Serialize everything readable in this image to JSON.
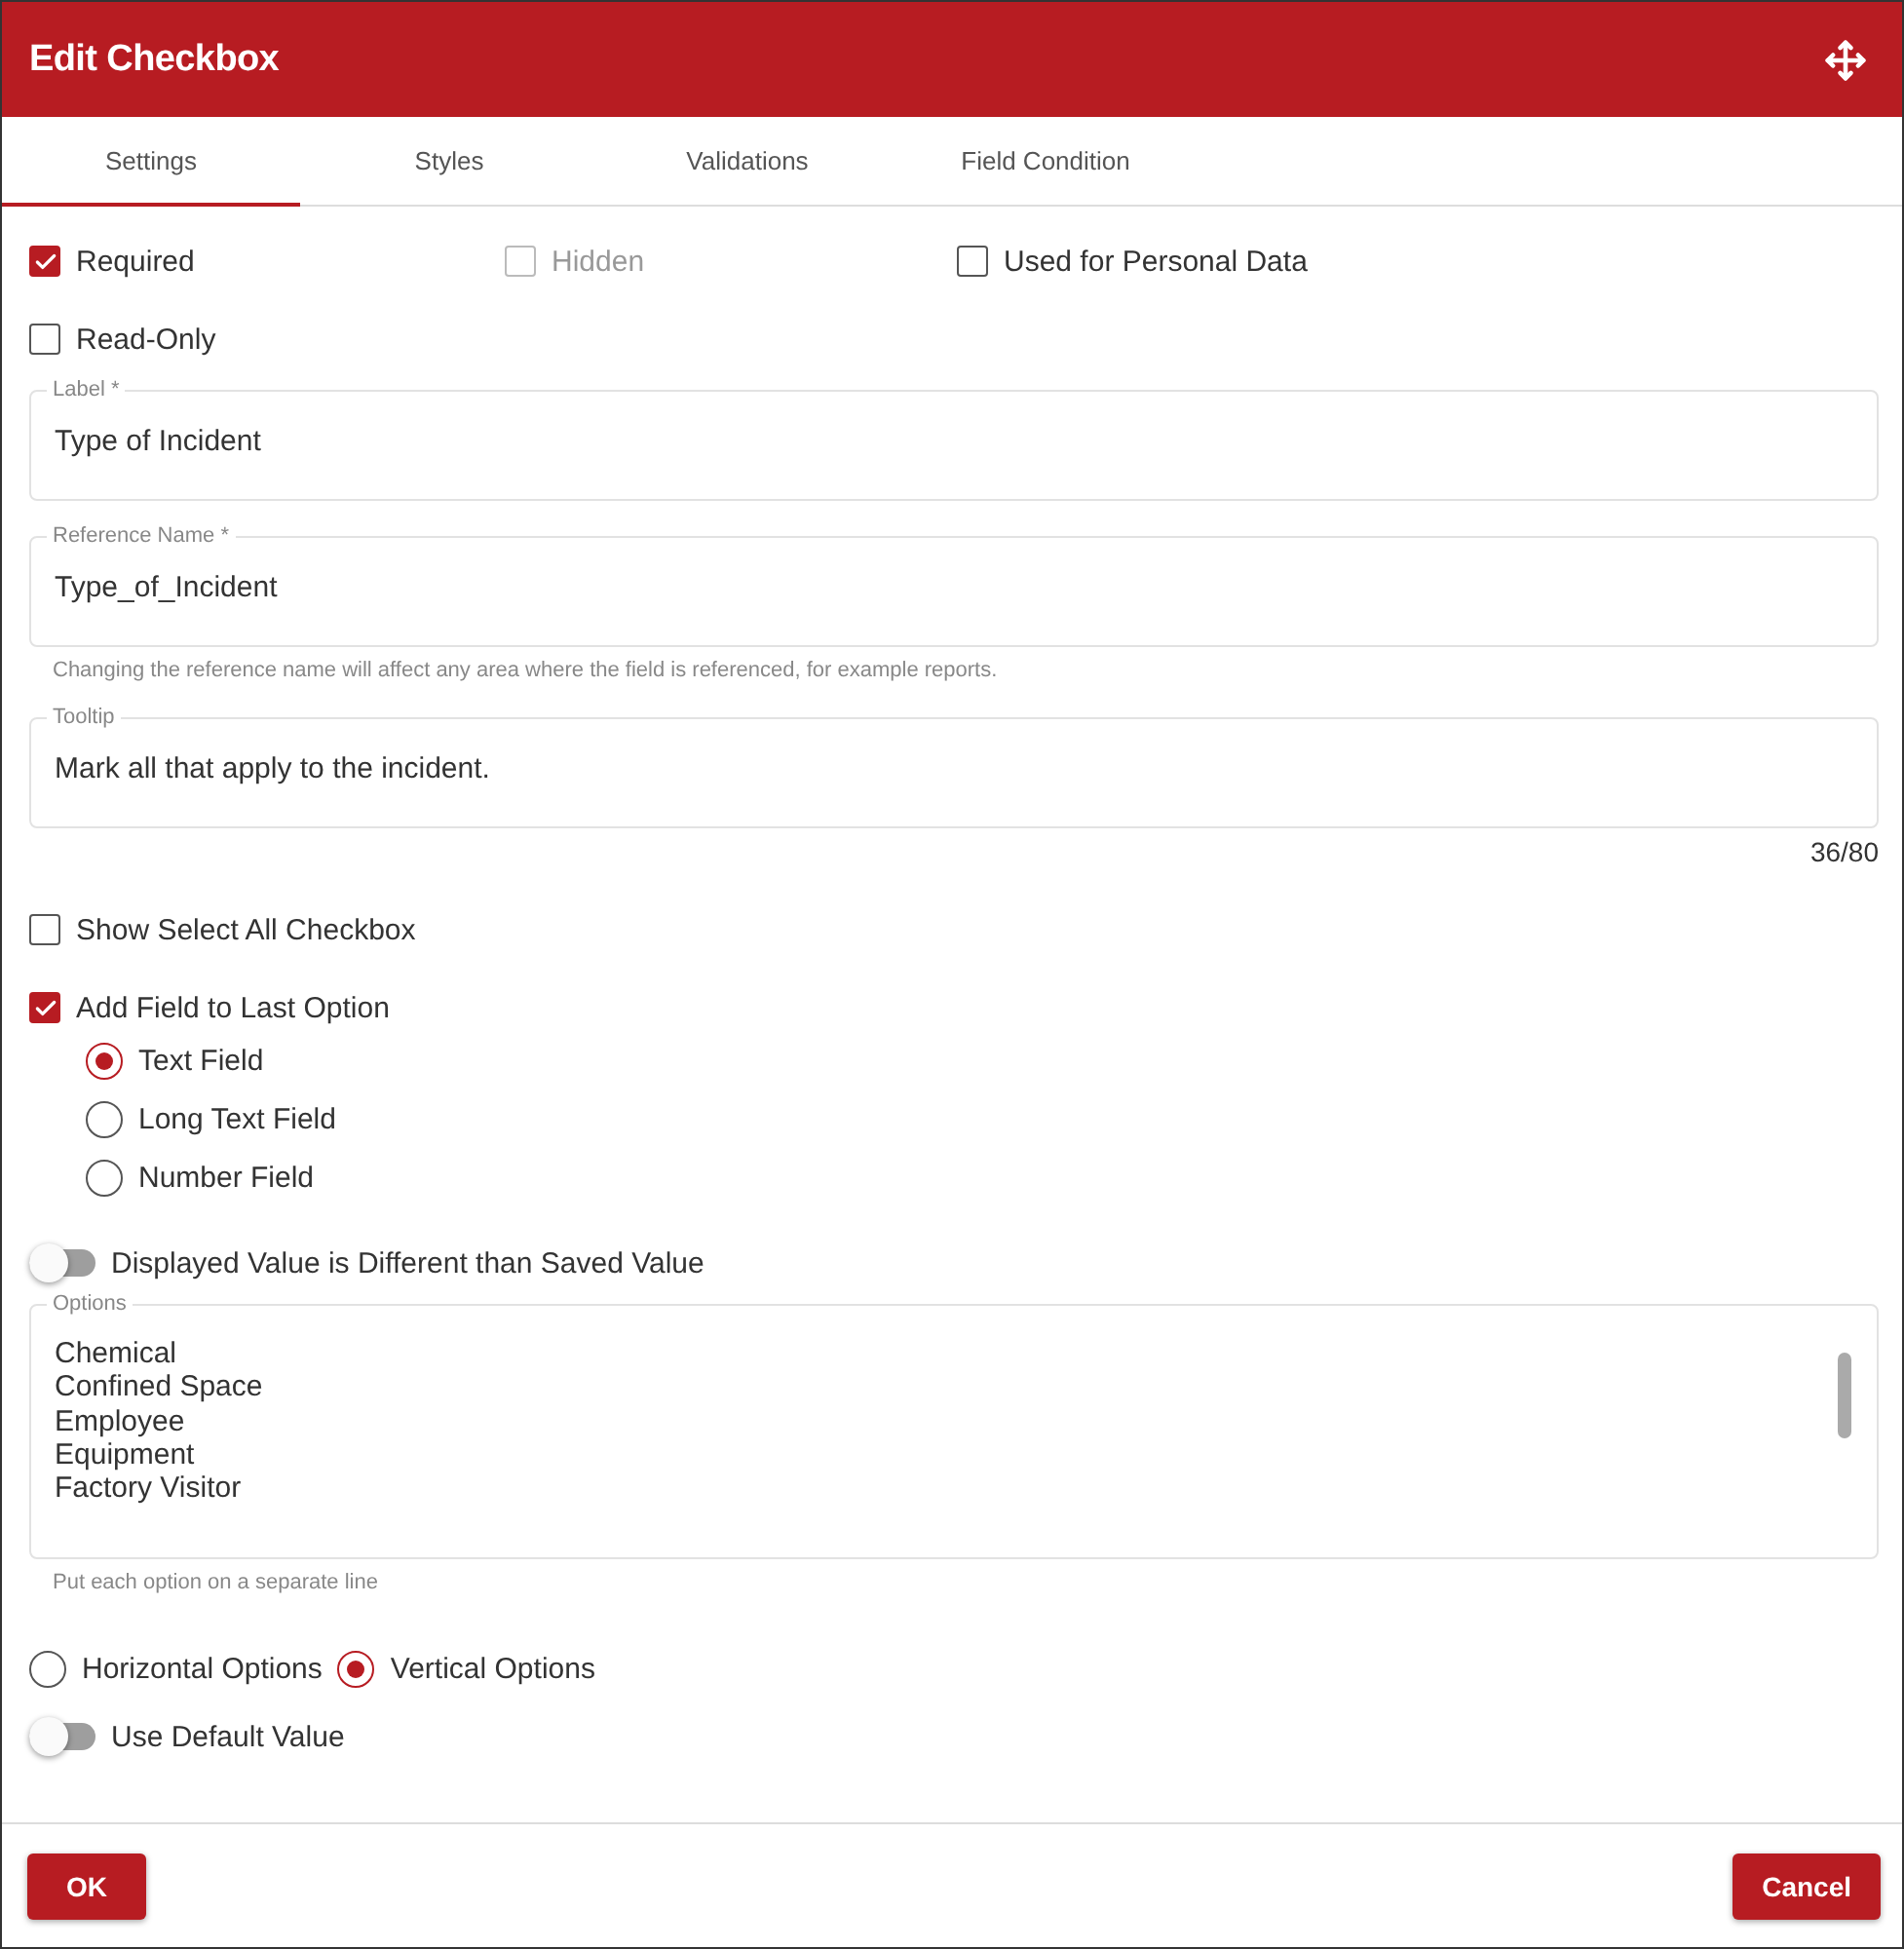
{
  "dialog": {
    "title": "Edit Checkbox"
  },
  "tabs": [
    {
      "label": "Settings",
      "selected": true
    },
    {
      "label": "Styles",
      "selected": false
    },
    {
      "label": "Validations",
      "selected": false
    },
    {
      "label": "Field Condition",
      "selected": false
    }
  ],
  "flags": [
    {
      "label": "Required",
      "checked": true,
      "disabled": false
    },
    {
      "label": "Hidden",
      "checked": false,
      "disabled": true
    },
    {
      "label": "Used for Personal Data",
      "checked": false,
      "disabled": false
    },
    {
      "label": "Read-Only",
      "checked": false,
      "disabled": false
    }
  ],
  "fields": [
    {
      "label": "Label *",
      "value": "Type of Incident"
    },
    {
      "label": "Reference Name *",
      "value": "Type_of_Incident",
      "hint": "Changing the reference name will affect any area where the field is referenced, for example reports."
    },
    {
      "label": "Tooltip",
      "value": "Mark all that apply to the incident.",
      "counter": "36/80"
    }
  ],
  "show_select_all": {
    "label": "Show Select All Checkbox",
    "checked": false
  },
  "add_field": {
    "label": "Add Field to Last Option",
    "checked": true
  },
  "field_types": [
    {
      "label": "Text Field",
      "selected": true
    },
    {
      "label": "Long Text Field",
      "selected": false
    },
    {
      "label": "Number Field",
      "selected": false
    }
  ],
  "displayed_toggle": {
    "label": "Displayed Value is Different than Saved Value",
    "on": false
  },
  "options": {
    "label": "Options",
    "lines": [
      "Chemical",
      "Confined Space",
      "Employee",
      "Equipment",
      "Factory Visitor"
    ],
    "hint": "Put each option on a separate line"
  },
  "orientation": [
    {
      "label": "Horizontal Options",
      "selected": false
    },
    {
      "label": "Vertical Options",
      "selected": true
    }
  ],
  "default_toggle": {
    "label": "Use Default Value",
    "on": false
  },
  "buttons": [
    {
      "label": "OK"
    },
    {
      "label": "Cancel"
    }
  ]
}
